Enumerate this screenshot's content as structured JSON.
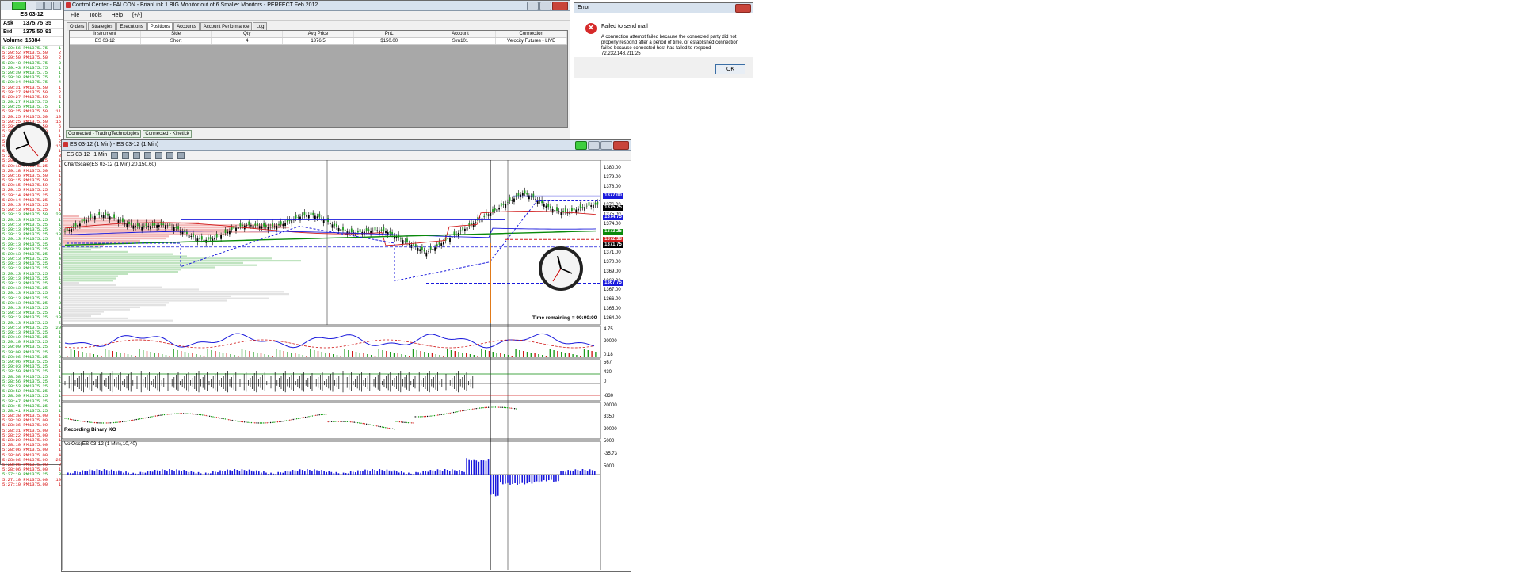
{
  "ts": {
    "instrument": "ES 03-12",
    "quotes": [
      {
        "label": "Ask",
        "price": "1375.75",
        "size": "35"
      },
      {
        "label": "Bid",
        "price": "1375.50",
        "size": "91"
      },
      {
        "label": "Volume",
        "price": "15384",
        "size": ""
      }
    ],
    "rows": [
      {
        "t": "5:29:56 PM",
        "p": "1375.75",
        "s": "1",
        "c": "up"
      },
      {
        "t": "5:29:52 PM",
        "p": "1375.50",
        "s": "2",
        "c": "dn"
      },
      {
        "t": "5:29:50 PM",
        "p": "1375.50",
        "s": "2",
        "c": "dn"
      },
      {
        "t": "5:29:48 PM",
        "p": "1375.75",
        "s": "3",
        "c": "up"
      },
      {
        "t": "5:29:43 PM",
        "p": "1375.75",
        "s": "1",
        "c": "up"
      },
      {
        "t": "5:29:39 PM",
        "p": "1375.75",
        "s": "1",
        "c": "up"
      },
      {
        "t": "5:29:38 PM",
        "p": "1375.75",
        "s": "1",
        "c": "up"
      },
      {
        "t": "5:29:34 PM",
        "p": "1375.75",
        "s": "4",
        "c": "up"
      },
      {
        "t": "5:29:31 PM",
        "p": "1375.50",
        "s": "1",
        "c": "dn"
      },
      {
        "t": "5:29:27 PM",
        "p": "1375.50",
        "s": "2",
        "c": "dn"
      },
      {
        "t": "5:29:27 PM",
        "p": "1375.50",
        "s": "5",
        "c": "dn"
      },
      {
        "t": "5:29:27 PM",
        "p": "1375.75",
        "s": "1",
        "c": "up"
      },
      {
        "t": "5:29:25 PM",
        "p": "1375.75",
        "s": "1",
        "c": "up"
      },
      {
        "t": "5:29:25 PM",
        "p": "1375.50",
        "s": "11",
        "c": "dn"
      },
      {
        "t": "5:29:25 PM",
        "p": "1375.50",
        "s": "10",
        "c": "dn"
      },
      {
        "t": "5:29:25 PM",
        "p": "1375.50",
        "s": "15",
        "c": "dn"
      },
      {
        "t": "5:29:23 PM",
        "p": "1375.50",
        "s": "6",
        "c": "dn"
      },
      {
        "t": "5:29:23 PM",
        "p": "1375.50",
        "s": "1",
        "c": "dn"
      },
      {
        "t": "5:29:20 PM",
        "p": "1375.50",
        "s": "1",
        "c": "dn"
      },
      {
        "t": "5:29:20 PM",
        "p": "1375.50",
        "s": "2",
        "c": "dn"
      },
      {
        "t": "5:29:20 PM",
        "p": "1375.50",
        "s": "15",
        "c": "dn"
      },
      {
        "t": "5:29:20 PM",
        "p": "1375.50",
        "s": "1",
        "c": "dn"
      },
      {
        "t": "5:29:19 PM",
        "p": "1375.50",
        "s": "3",
        "c": "dn"
      },
      {
        "t": "5:29:18 PM",
        "p": "1375.25",
        "s": "1",
        "c": "dn"
      },
      {
        "t": "5:29:18 PM",
        "p": "1375.25",
        "s": "1",
        "c": "dn"
      },
      {
        "t": "5:29:18 PM",
        "p": "1375.50",
        "s": "1",
        "c": "dn"
      },
      {
        "t": "5:29:16 PM",
        "p": "1375.50",
        "s": "1",
        "c": "dn"
      },
      {
        "t": "5:29:15 PM",
        "p": "1375.50",
        "s": "1",
        "c": "dn"
      },
      {
        "t": "5:29:15 PM",
        "p": "1375.50",
        "s": "2",
        "c": "dn"
      },
      {
        "t": "5:29:15 PM",
        "p": "1375.25",
        "s": "1",
        "c": "dn"
      },
      {
        "t": "5:29:14 PM",
        "p": "1375.25",
        "s": "2",
        "c": "dn"
      },
      {
        "t": "5:29:14 PM",
        "p": "1375.25",
        "s": "3",
        "c": "dn"
      },
      {
        "t": "5:29:13 PM",
        "p": "1375.25",
        "s": "1",
        "c": "dn"
      },
      {
        "t": "5:29:13 PM",
        "p": "1375.25",
        "s": "1",
        "c": "dn"
      },
      {
        "t": "5:29:13 PM",
        "p": "1375.50",
        "s": "20",
        "c": "up"
      },
      {
        "t": "5:29:13 PM",
        "p": "1375.25",
        "s": "1",
        "c": "up"
      },
      {
        "t": "5:29:13 PM",
        "p": "1375.25",
        "s": "1",
        "c": "up"
      },
      {
        "t": "5:29:13 PM",
        "p": "1375.25",
        "s": "2",
        "c": "up"
      },
      {
        "t": "5:29:13 PM",
        "p": "1375.25",
        "s": "10",
        "c": "up"
      },
      {
        "t": "5:29:13 PM",
        "p": "1375.25",
        "s": "2",
        "c": "up"
      },
      {
        "t": "5:29:13 PM",
        "p": "1375.25",
        "s": "3",
        "c": "up"
      },
      {
        "t": "5:29:13 PM",
        "p": "1375.25",
        "s": "1",
        "c": "up"
      },
      {
        "t": "5:29:13 PM",
        "p": "1375.25",
        "s": "1",
        "c": "up"
      },
      {
        "t": "5:29:13 PM",
        "p": "1375.25",
        "s": "4",
        "c": "up"
      },
      {
        "t": "5:29:13 PM",
        "p": "1375.25",
        "s": "1",
        "c": "up"
      },
      {
        "t": "5:29:13 PM",
        "p": "1375.25",
        "s": "1",
        "c": "up"
      },
      {
        "t": "5:29:13 PM",
        "p": "1375.25",
        "s": "2",
        "c": "up"
      },
      {
        "t": "5:29:13 PM",
        "p": "1375.25",
        "s": "1",
        "c": "up"
      },
      {
        "t": "5:29:13 PM",
        "p": "1375.25",
        "s": "5",
        "c": "up"
      },
      {
        "t": "5:29:13 PM",
        "p": "1375.25",
        "s": "1",
        "c": "up"
      },
      {
        "t": "5:29:13 PM",
        "p": "1375.25",
        "s": "2",
        "c": "up"
      },
      {
        "t": "5:29:13 PM",
        "p": "1375.25",
        "s": "1",
        "c": "up"
      },
      {
        "t": "5:29:13 PM",
        "p": "1375.25",
        "s": "3",
        "c": "up"
      },
      {
        "t": "5:29:13 PM",
        "p": "1375.25",
        "s": "1",
        "c": "up"
      },
      {
        "t": "5:29:13 PM",
        "p": "1375.25",
        "s": "1",
        "c": "up"
      },
      {
        "t": "5:29:13 PM",
        "p": "1375.25",
        "s": "10",
        "c": "up"
      },
      {
        "t": "5:29:13 PM",
        "p": "1375.25",
        "s": "2",
        "c": "up"
      },
      {
        "t": "5:29:13 PM",
        "p": "1375.25",
        "s": "20",
        "c": "up"
      },
      {
        "t": "5:29:13 PM",
        "p": "1375.25",
        "s": "1",
        "c": "up"
      },
      {
        "t": "5:29:10 PM",
        "p": "1375.25",
        "s": "1",
        "c": "up"
      },
      {
        "t": "5:29:10 PM",
        "p": "1375.25",
        "s": "1",
        "c": "up"
      },
      {
        "t": "5:29:09 PM",
        "p": "1375.25",
        "s": "1",
        "c": "up"
      },
      {
        "t": "5:29:08 PM",
        "p": "1375.25",
        "s": "1",
        "c": "up"
      },
      {
        "t": "5:29:06 PM",
        "p": "1375.25",
        "s": "2",
        "c": "up"
      },
      {
        "t": "5:29:06 PM",
        "p": "1375.25",
        "s": "1",
        "c": "up"
      },
      {
        "t": "5:29:03 PM",
        "p": "1375.25",
        "s": "1",
        "c": "up"
      },
      {
        "t": "5:28:59 PM",
        "p": "1375.25",
        "s": "1",
        "c": "up"
      },
      {
        "t": "5:28:58 PM",
        "p": "1375.25",
        "s": "1",
        "c": "up"
      },
      {
        "t": "5:28:56 PM",
        "p": "1375.25",
        "s": "1",
        "c": "up"
      },
      {
        "t": "5:28:53 PM",
        "p": "1375.25",
        "s": "1",
        "c": "up"
      },
      {
        "t": "5:28:52 PM",
        "p": "1375.25",
        "s": "1",
        "c": "up"
      },
      {
        "t": "5:28:50 PM",
        "p": "1375.25",
        "s": "1",
        "c": "up"
      },
      {
        "t": "5:28:47 PM",
        "p": "1375.25",
        "s": "1",
        "c": "up"
      },
      {
        "t": "5:28:45 PM",
        "p": "1375.25",
        "s": "1",
        "c": "up"
      },
      {
        "t": "5:28:41 PM",
        "p": "1375.25",
        "s": "1",
        "c": "up"
      },
      {
        "t": "5:28:38 PM",
        "p": "1375.00",
        "s": "1",
        "c": "dn"
      },
      {
        "t": "5:28:38 PM",
        "p": "1375.00",
        "s": "1",
        "c": "dn"
      },
      {
        "t": "5:28:36 PM",
        "p": "1375.00",
        "s": "1",
        "c": "dn"
      },
      {
        "t": "5:28:31 PM",
        "p": "1375.00",
        "s": "1",
        "c": "dn"
      },
      {
        "t": "5:28:22 PM",
        "p": "1375.00",
        "s": "1",
        "c": "dn"
      },
      {
        "t": "5:28:20 PM",
        "p": "1375.00",
        "s": "1",
        "c": "dn"
      },
      {
        "t": "5:28:10 PM",
        "p": "1375.00",
        "s": "1",
        "c": "dn"
      },
      {
        "t": "5:28:06 PM",
        "p": "1375.00",
        "s": "1",
        "c": "dn"
      },
      {
        "t": "5:28:06 PM",
        "p": "1375.00",
        "s": "4",
        "c": "dn"
      },
      {
        "t": "5:28:06 PM",
        "p": "1375.00",
        "s": "25",
        "c": "dn"
      },
      {
        "t": "5:28:06 PM",
        "p": "1375.00",
        "s": "2",
        "c": "dn"
      },
      {
        "t": "5:28:06 PM",
        "p": "1375.00",
        "s": "1",
        "c": "dn"
      },
      {
        "t": "5:27:10 PM",
        "p": "1375.25",
        "s": "3",
        "c": "up"
      },
      {
        "t": "5:27:10 PM",
        "p": "1375.00",
        "s": "10",
        "c": "dn"
      },
      {
        "t": "5:27:10 PM",
        "p": "1375.00",
        "s": "1",
        "c": "dn"
      }
    ]
  },
  "cc": {
    "title": "Control Center - FALCON - BrianLink 1 BIG Monitor out of 6 Smaller Monitors - PERFECT Feb 2012",
    "menu": [
      "File",
      "Tools",
      "Help",
      "[+/-]"
    ],
    "tabs": [
      "Orders",
      "Strategies",
      "Executions",
      "Positions",
      "Accounts",
      "Account Performance",
      "Log"
    ],
    "active_tab": "Positions",
    "columns": [
      "Instrument",
      "Side",
      "Qty",
      "Avg Price",
      "PnL",
      "Account",
      "Connection"
    ],
    "row": [
      "ES 03-12",
      "Short",
      "4",
      "1376.5",
      "$150.00",
      "Sim101",
      "Velocity Futures - LIVE"
    ],
    "status": [
      "Connected - TradingTechnologies",
      "Connected - Kinetick"
    ]
  },
  "err": {
    "title": "Error",
    "heading": "Failed to send mail",
    "message": "A connection attempt failed because the connected party did not properly respond after a period of time, or established connection failed because connected host has failed to respond 72.232.148.211:25",
    "ok": "OK"
  },
  "chart": {
    "title": "ES 03-12 (1 Min) - ES 03-12 (1 Min)",
    "instrument": "ES 03-12",
    "interval": "1 Min",
    "label1": "ChartScale(ES 03-12 (1 Min),20,150,60)",
    "time_remaining": "Time remaining = 00:00:00",
    "label4": "Recording Binary KO",
    "label5": "VolOsc(ES 03-12 (1 Min),10,40)",
    "price_axis": [
      "1380.00",
      "1379.00",
      "1378.00",
      "1377.00",
      "1376.00",
      "1375.00",
      "1374.00",
      "1373.00",
      "1372.00",
      "1371.00",
      "1370.00",
      "1369.00",
      "1368.00",
      "1367.00",
      "1366.00",
      "1365.00",
      "1364.00"
    ],
    "tags": [
      {
        "v": "1377.00",
        "color": "#1a1adc"
      },
      {
        "v": "1375.75",
        "color": "#000000"
      },
      {
        "v": "1374.75",
        "color": "#1a1adc"
      },
      {
        "v": "1373.25",
        "color": "#0a8a0a"
      },
      {
        "v": "1372.38",
        "color": "#d11a1a"
      },
      {
        "v": "1371.75",
        "color": "#000000"
      },
      {
        "v": "1367.75",
        "color": "#1a1adc"
      }
    ],
    "p2_axis": [
      "4.75",
      "20000",
      "0.18"
    ],
    "p3_axis": [
      "567",
      "430",
      "0",
      "-830"
    ],
    "p4_axis": [
      "20000",
      "3350",
      "20000"
    ],
    "p5_axis": [
      "5000",
      "-35.73",
      "5000"
    ]
  }
}
